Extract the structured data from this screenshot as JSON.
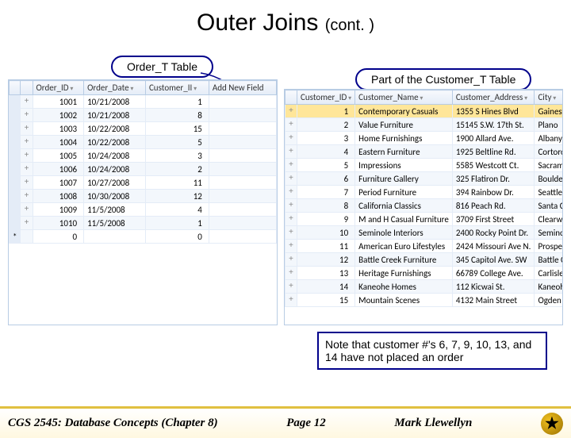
{
  "title_main": "Outer Joins",
  "title_cont": "(cont. )",
  "label_order": "Order_T Table",
  "label_customer": "Part of the Customer_T Table",
  "order_table": {
    "headers": [
      "",
      "",
      "Order_ID",
      "Order_Date",
      "Customer_II",
      "Add New Field"
    ],
    "rows": [
      [
        "",
        "+",
        "1001",
        "10/21/2008",
        "1",
        ""
      ],
      [
        "",
        "+",
        "1002",
        "10/21/2008",
        "8",
        ""
      ],
      [
        "",
        "+",
        "1003",
        "10/22/2008",
        "15",
        ""
      ],
      [
        "",
        "+",
        "1004",
        "10/22/2008",
        "5",
        ""
      ],
      [
        "",
        "+",
        "1005",
        "10/24/2008",
        "3",
        ""
      ],
      [
        "",
        "+",
        "1006",
        "10/24/2008",
        "2",
        ""
      ],
      [
        "",
        "+",
        "1007",
        "10/27/2008",
        "11",
        ""
      ],
      [
        "",
        "+",
        "1008",
        "10/30/2008",
        "12",
        ""
      ],
      [
        "",
        "+",
        "1009",
        "11/5/2008",
        "4",
        ""
      ],
      [
        "",
        "+",
        "1010",
        "11/5/2008",
        "1",
        ""
      ],
      [
        "*",
        "",
        "0",
        "",
        "0",
        ""
      ]
    ]
  },
  "customer_table": {
    "headers": [
      "",
      "Customer_ID",
      "Customer_Name",
      "Customer_Address",
      "City"
    ],
    "rows": [
      [
        "+",
        "1",
        "Contemporary Casuals",
        "1355 S Hines Blvd",
        "Gainesvi"
      ],
      [
        "+",
        "2",
        "Value Furniture",
        "15145 S.W. 17th St.",
        "Plano"
      ],
      [
        "+",
        "3",
        "Home Furnishings",
        "1900 Allard Ave.",
        "Albany"
      ],
      [
        "+",
        "4",
        "Eastern Furniture",
        "1925 Beltline Rd.",
        "Cortorcel"
      ],
      [
        "+",
        "5",
        "Impressions",
        "5585 Westcott Ct.",
        "Sacrame"
      ],
      [
        "+",
        "6",
        "Furniture Gallery",
        "325 Flatiron Dr.",
        "Boulder"
      ],
      [
        "+",
        "7",
        "Period Furniture",
        "394 Rainbow Dr.",
        "Seattle"
      ],
      [
        "+",
        "8",
        "California Classics",
        "816 Peach Rd.",
        "Santa Cla"
      ],
      [
        "+",
        "9",
        "M and H Casual Furniture",
        "3709 First Street",
        "Clearwat"
      ],
      [
        "+",
        "10",
        "Seminole Interiors",
        "2400 Rocky Point Dr.",
        "Seminol"
      ],
      [
        "+",
        "11",
        "American Euro Lifestyles",
        "2424 Missouri Ave N.",
        "Prospect"
      ],
      [
        "+",
        "12",
        "Battle Creek Furniture",
        "345 Capitol Ave. SW",
        "Battle Cr"
      ],
      [
        "+",
        "13",
        "Heritage Furnishings",
        "66789 College Ave.",
        "Carlisle"
      ],
      [
        "+",
        "14",
        "Kaneohe Homes",
        "112 Kicwai St.",
        "Kaneohe"
      ],
      [
        "+",
        "15",
        "Mountain Scenes",
        "4132 Main Street",
        "Ogden"
      ]
    ]
  },
  "note": "Note that customer #'s 6, 7, 9, 10, 13, and 14 have not placed an order",
  "footer": {
    "left": "CGS 2545: Database Concepts  (Chapter 8)",
    "center": "Page 12",
    "right": "Mark Llewellyn"
  }
}
